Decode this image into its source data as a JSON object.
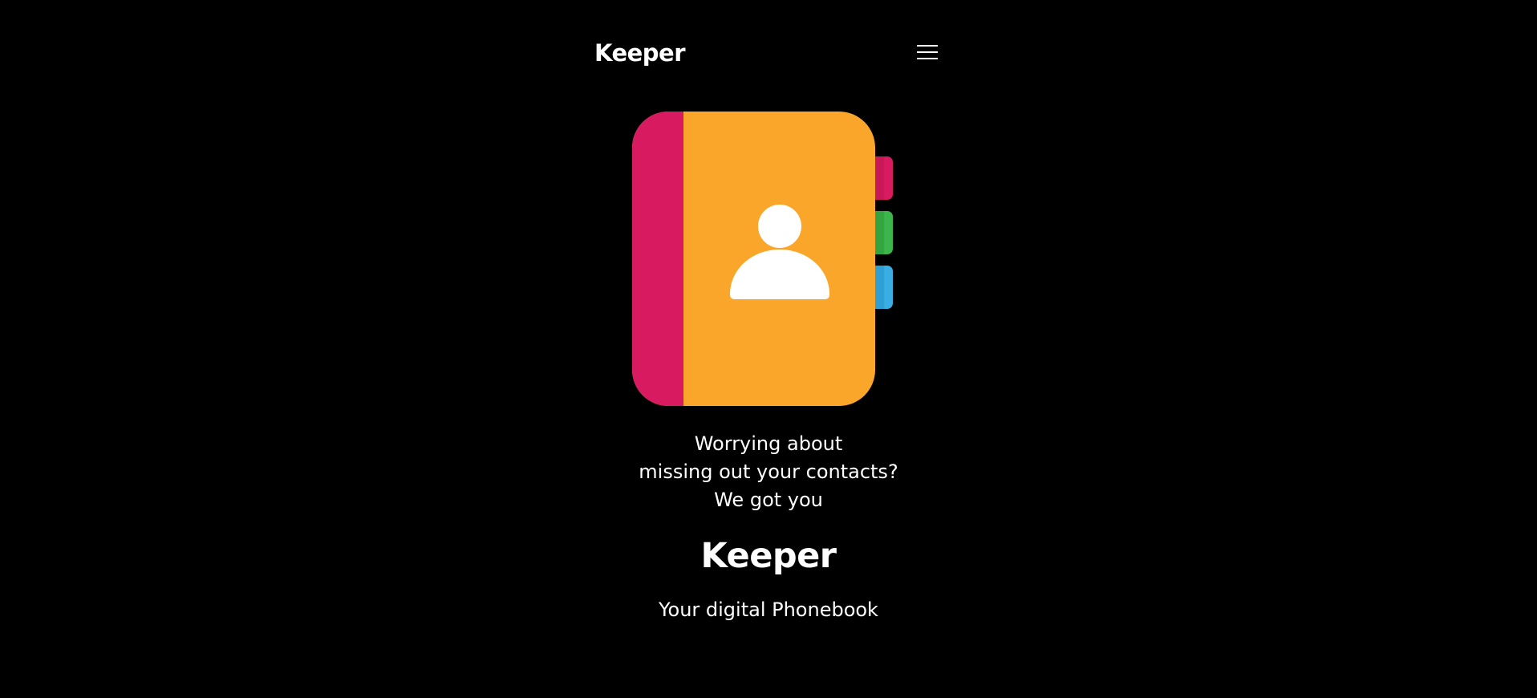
{
  "navbar": {
    "brand": "Keeper",
    "menu_icon": "hamburger-menu-icon"
  },
  "hero": {
    "illustration_icon": "contact-book-icon",
    "tagline_lines": [
      "Worrying about",
      "missing out your contacts?",
      "We got you"
    ],
    "title": "Keeper",
    "subtitle": "Your digital Phonebook"
  },
  "colors": {
    "background": "#000000",
    "text": "#ffffff",
    "book_cover": "#f9a62b",
    "book_spine": "#d81b60",
    "tab_pink": "#d81b60",
    "tab_green": "#3cb54a",
    "tab_blue": "#39aee5"
  }
}
